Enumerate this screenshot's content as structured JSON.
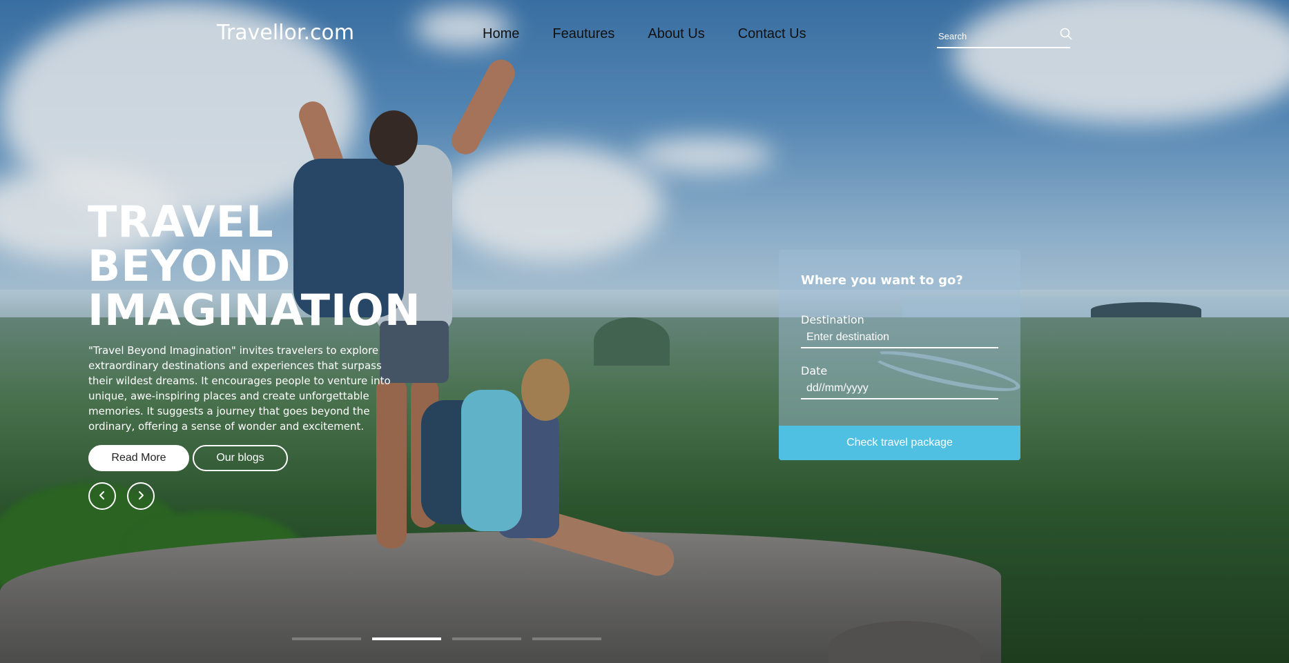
{
  "header": {
    "logo": "Travellor.com",
    "nav": [
      "Home",
      "Feautures",
      "About Us",
      "Contact Us"
    ],
    "search_placeholder": "Search",
    "search_icon": "search-icon"
  },
  "hero": {
    "title": "TRAVEL\nBEYOND\nIMAGINATION",
    "description": "\"Travel Beyond Imagination\" invites travelers to explore extraordinary destinations and experiences that surpass their wildest dreams. It encourages people to venture into unique, awe-inspiring places and create unforgettable memories. It suggests a journey that goes beyond the ordinary, offering a sense of wonder and excitement.",
    "read_more_label": "Read More",
    "blogs_label": "Our blogs",
    "prev_icon": "chevron-left-icon",
    "next_icon": "chevron-right-icon"
  },
  "booking": {
    "title": "Where you want to go?",
    "destination_label": "Destination",
    "destination_placeholder": "Enter destination",
    "date_label": "Date",
    "date_placeholder": "dd//mm/yyyy",
    "submit_label": "Check travel package"
  },
  "slider": {
    "slide_count": 4,
    "active_index": 1
  },
  "colors": {
    "accent": "#4fc0e2",
    "text_light": "#ffffff",
    "nav_text": "#111111"
  }
}
